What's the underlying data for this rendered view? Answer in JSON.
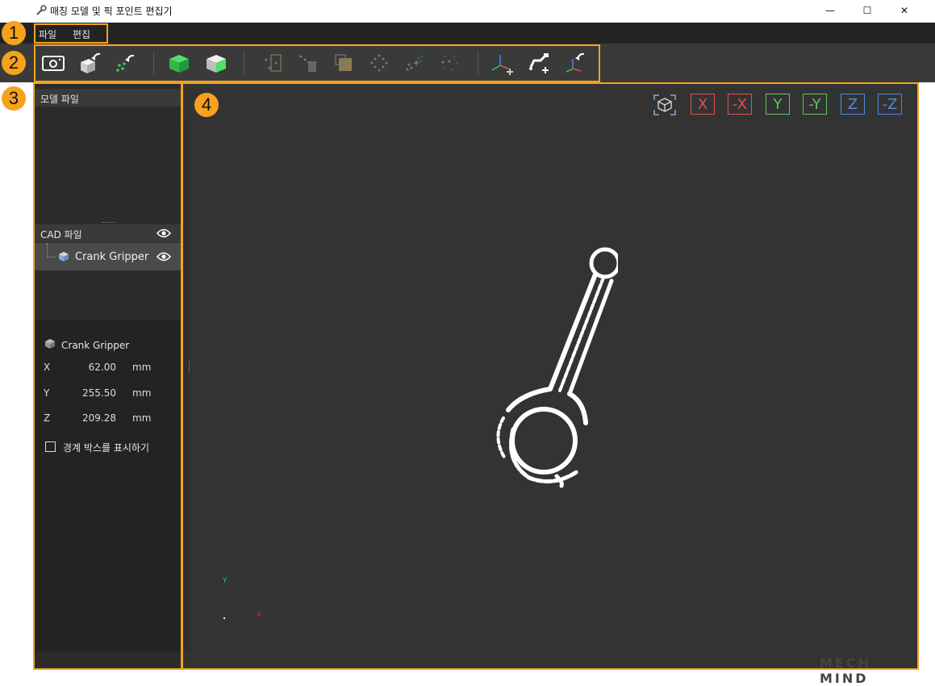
{
  "window": {
    "title": "매칭 모델 및 픽 포인트 편집기",
    "minimize": "—",
    "maximize": "☐",
    "close": "✕"
  },
  "menu": {
    "items": [
      "파일",
      "편집"
    ]
  },
  "callouts": [
    "1",
    "2",
    "3",
    "4"
  ],
  "left_panel": {
    "model_file_header": "모델 파일",
    "cad_header": "CAD 파일",
    "cad_item": "Crank Gripper",
    "props": {
      "name": "Crank Gripper",
      "x_label": "X",
      "x_value": "62.00",
      "x_unit": "mm",
      "y_label": "Y",
      "y_value": "255.50",
      "y_unit": "mm",
      "z_label": "Z",
      "z_value": "209.28",
      "z_unit": "mm"
    },
    "bbox_checkbox": "경계 박스를 표시하기"
  },
  "viewport": {
    "view_buttons": [
      "X",
      "-X",
      "Y",
      "-Y",
      "Z",
      "-Z"
    ],
    "view_colors": [
      "#e05050",
      "#e05050",
      "#5cc85c",
      "#5cc85c",
      "#4a8be0",
      "#4a8be0"
    ],
    "axis_y": "Y",
    "axis_x": "X",
    "watermark": "MECH MIND"
  },
  "colors": {
    "accent": "#f6a21c",
    "point_cloud": "#ffffff",
    "green_points": "#33cc55"
  }
}
